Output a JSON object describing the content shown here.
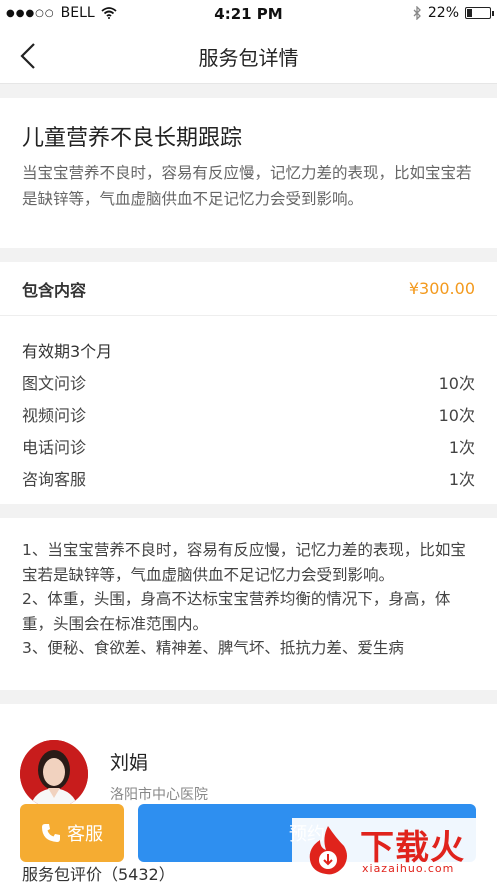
{
  "status_bar": {
    "carrier": "BELL",
    "time": "4:21 PM",
    "battery": "22%",
    "battery_level": 0.22
  },
  "nav": {
    "title": "服务包详情"
  },
  "intro": {
    "title": "儿童营养不良长期跟踪",
    "description": "当宝宝营养不良时，容易有反应慢，记忆力差的表现，比如宝宝若是缺锌等，气血虚脑供血不足记忆力会受到影响。"
  },
  "package": {
    "label": "包含内容",
    "price": "¥300.00",
    "validity": "有效期3个月",
    "items": [
      {
        "name": "图文问诊",
        "count": "10次"
      },
      {
        "name": "视频问诊",
        "count": "10次"
      },
      {
        "name": "电话问诊",
        "count": "1次"
      },
      {
        "name": "咨询客服",
        "count": "1次"
      }
    ]
  },
  "details": {
    "line1": "1、当宝宝营养不良时，容易有反应慢，记忆力差的表现，比如宝宝若是缺锌等，气血虚脑供血不足记忆力会受到影响。",
    "line2": "2、体重，头围，身高不达标宝宝营养均衡的情况下，身高，体重，头围会在标准范围内。",
    "line3": "3、便秘、食欲差、精神差、脾气坏、抵抗力差、爱生病"
  },
  "doctor": {
    "name": "刘娟",
    "hospital": "洛阳市中心医院"
  },
  "reviews": {
    "label": "服务包评价（5432）"
  },
  "actions": {
    "service_label": "客服",
    "book_label": "预约"
  },
  "watermark": {
    "logo_text": "下载火",
    "domain": "xiazaihuo.com"
  },
  "colors": {
    "price": "#f39a1e",
    "service_button": "#f5ac32",
    "book_button": "#2e8ff0",
    "watermark": "#e0231c"
  }
}
